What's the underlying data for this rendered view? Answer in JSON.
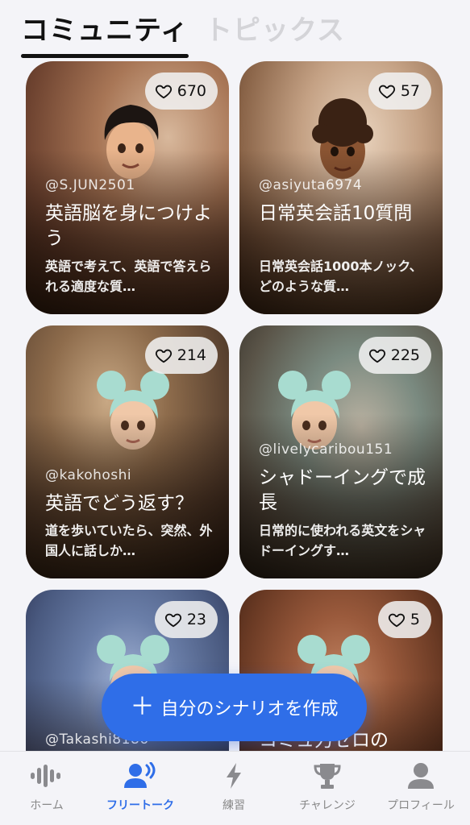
{
  "tabs": {
    "active": "コミュニティ",
    "inactive": "トピックス"
  },
  "cards": [
    {
      "likes": "670",
      "user": "@S.JUN2501",
      "title": "英語脳を身につけよう",
      "desc": "英語で考えて、英語で答えられる適度な質…"
    },
    {
      "likes": "57",
      "user": "@asiyuta6974",
      "title": "日常英会話10質問",
      "desc": "日常英会話1000本ノック、どのような質…"
    },
    {
      "likes": "214",
      "user": "@kakohoshi",
      "title": "英語でどう返す？",
      "desc": "道を歩いていたら、突然、外国人に話しか…"
    },
    {
      "likes": "225",
      "user": "@livelycaribou151",
      "title": "シャドーイングで成長",
      "desc": "日常的に使われる英文をシャドーイングす…"
    },
    {
      "likes": "23",
      "user": "@Takashi8186",
      "title": "",
      "desc": ""
    },
    {
      "likes": "5",
      "user": "",
      "title": "コミュ力ゼロの",
      "desc": ""
    }
  ],
  "fab": {
    "label": "自分のシナリオを作成"
  },
  "nav": [
    {
      "label": "ホーム",
      "icon": "waveform-icon"
    },
    {
      "label": "フリートーク",
      "icon": "speaking-person-icon"
    },
    {
      "label": "練習",
      "icon": "lightning-icon"
    },
    {
      "label": "チャレンジ",
      "icon": "trophy-icon"
    },
    {
      "label": "プロフィール",
      "icon": "person-icon"
    }
  ],
  "colors": {
    "accent": "#2f6ee8",
    "background": "#f4f4f8"
  }
}
